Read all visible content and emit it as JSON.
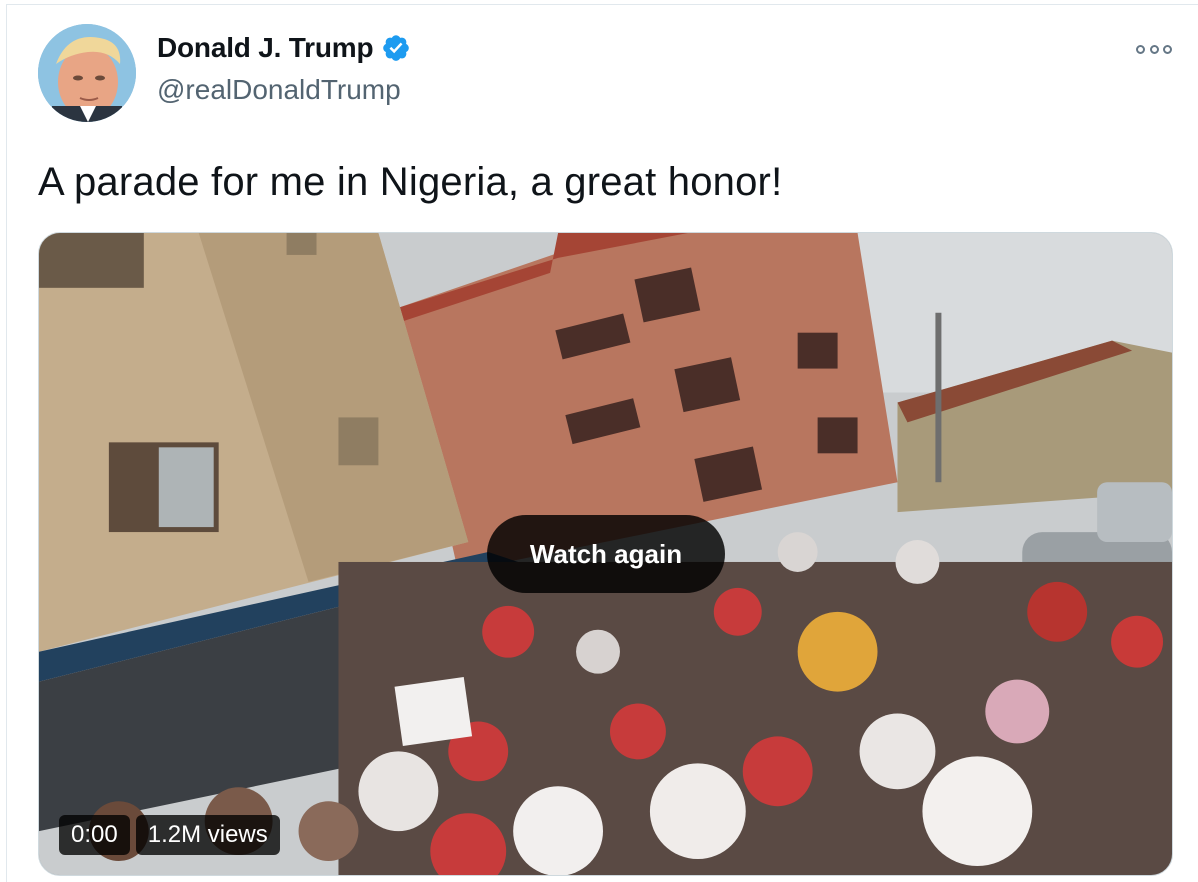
{
  "tweet": {
    "author": {
      "display_name": "Donald J. Trump",
      "handle": "@realDonaldTrump",
      "verified": true
    },
    "text": "A parade for me in Nigeria, a great honor!",
    "menu_icon": "more-icon"
  },
  "media": {
    "type": "video",
    "overlay_button": "Watch again",
    "timestamp": "0:00",
    "views": "1.2M views"
  },
  "colors": {
    "verified_blue": "#1d9bf0",
    "handle_gray": "#536471",
    "border": "#cfd9de"
  }
}
